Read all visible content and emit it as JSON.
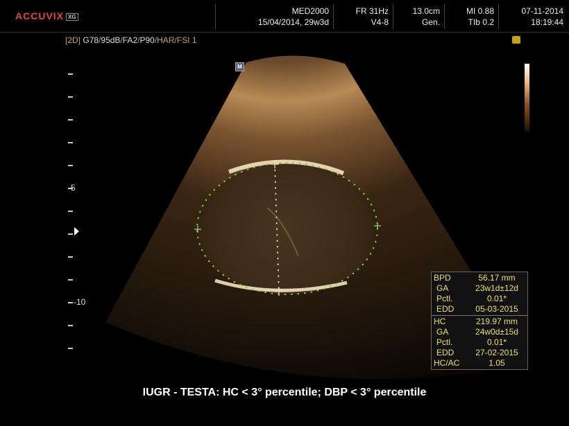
{
  "header": {
    "brand": "ACCUVIX",
    "brand_suffix": "XG",
    "institution": "MED2000",
    "patient_date_ga": "15/04/2014, 29w3d",
    "frame_rate": "FR 31Hz",
    "probe": "V4-8",
    "depth": "13.0cm",
    "preset": "Gen.",
    "mi": "MI 0.88",
    "tib": "TIb 0.2",
    "date": "07-11-2014",
    "time": "18:19:44"
  },
  "mode_line": {
    "mode": "[2D]",
    "gain": "G78",
    "dynamic_range": "95dB",
    "frame_avg": "FA2",
    "power": "P90",
    "harmonic": "HAR",
    "fsi": "FSI 1"
  },
  "marker_label": "M",
  "depth_labels": {
    "five": "-5",
    "ten": "-10"
  },
  "measurements": {
    "bpd": {
      "label": "BPD",
      "value": "56.17 mm",
      "ga_label": "GA",
      "ga": "23w1d±12d",
      "pctl_label": "Pctl.",
      "pctl": "0.01*",
      "edd_label": "EDD",
      "edd": "05-03-2015"
    },
    "hc": {
      "label": "HC",
      "value": "219.97 mm",
      "ga_label": "GA",
      "ga": "24w0d±15d",
      "pctl_label": "Pctl.",
      "pctl": "0.01*",
      "edd_label": "EDD",
      "edd": "27-02-2015",
      "ratio_label": "HC/AC",
      "ratio": "1.05"
    }
  },
  "caption": "IUGR - TESTA: HC < 3° percentile; DBP < 3° percentile",
  "colors": {
    "brand": "#e04a3a",
    "measure_text": "#f0e060",
    "mode_text": "#c8a35a",
    "caliper": "#7ed321"
  }
}
